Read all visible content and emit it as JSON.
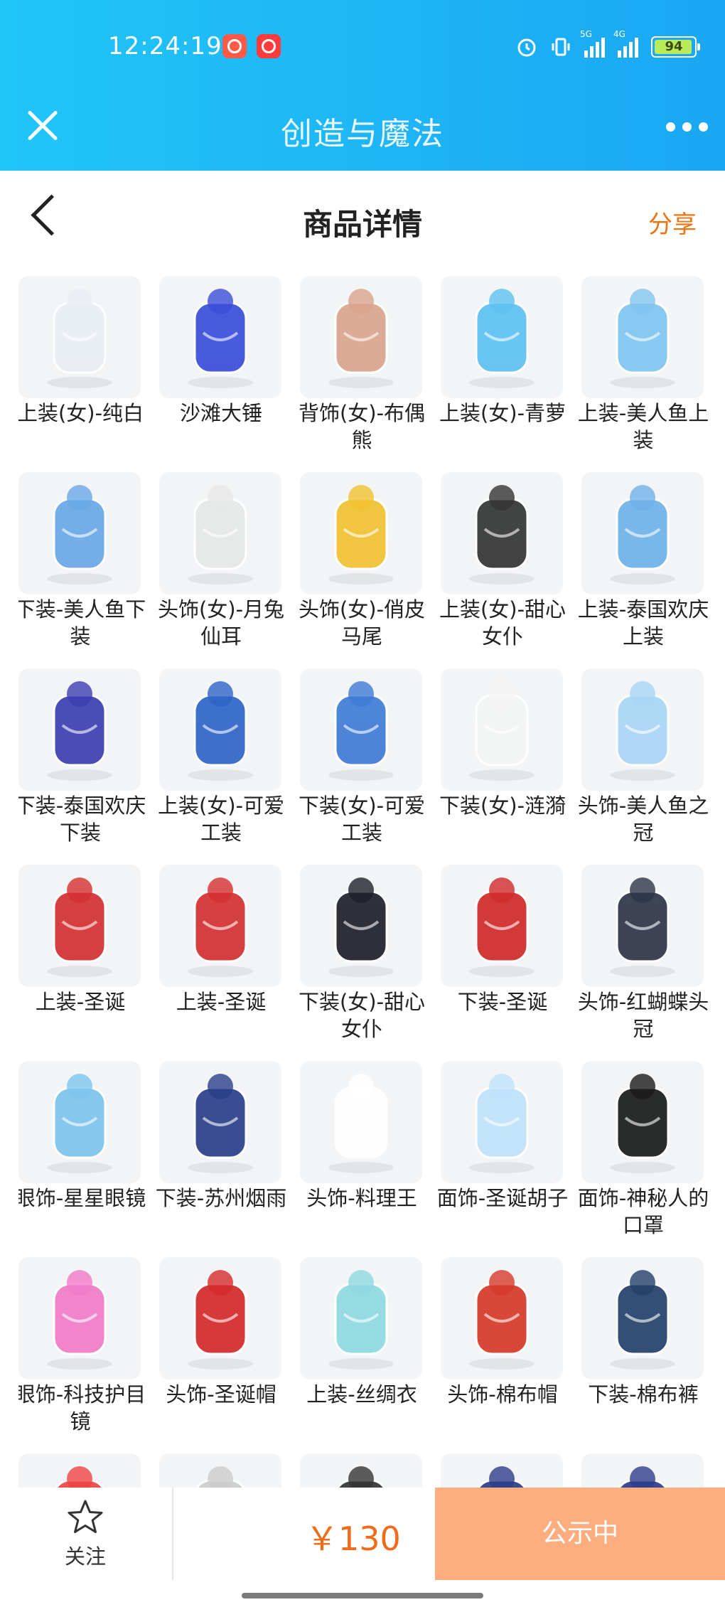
{
  "status_bar": {
    "time": "12:24:19",
    "network1": "5G",
    "network2": "4G",
    "battery": "94"
  },
  "app_bar": {
    "title": "创造与魔法"
  },
  "page_header": {
    "title": "商品详情",
    "share_label": "分享"
  },
  "items": [
    {
      "label": "上装(女)-纯白",
      "icon": "white-dress-icon",
      "color": "#e9edf3"
    },
    {
      "label": "沙滩大锤",
      "icon": "hammer-icon",
      "color": "#3a4ed8"
    },
    {
      "label": "背饰(女)-布偶熊",
      "icon": "teddy-bear-icon",
      "color": "#d9a48d"
    },
    {
      "label": "上装(女)-青萝",
      "icon": "blue-dress-icon",
      "color": "#5ec0f0"
    },
    {
      "label": "上装-美人鱼上装",
      "icon": "mermaid-top-icon",
      "color": "#7fc4f0"
    },
    {
      "label": "下装-美人鱼下装",
      "icon": "mermaid-pants-icon",
      "color": "#6aa8e8"
    },
    {
      "label": "头饰(女)-月兔仙耳",
      "icon": "bunny-ears-icon",
      "color": "#e7e7e7"
    },
    {
      "label": "头饰(女)-俏皮马尾",
      "icon": "ponytail-icon",
      "color": "#f2c030"
    },
    {
      "label": "上装(女)-甜心女仆",
      "icon": "maid-dress-icon",
      "color": "#333333"
    },
    {
      "label": "上装-泰国欢庆上装",
      "icon": "thai-top-icon",
      "color": "#6fb1e8"
    },
    {
      "label": "下装-泰国欢庆下装",
      "icon": "thai-pants-icon",
      "color": "#3b3fb0"
    },
    {
      "label": "上装(女)-可爱工装",
      "icon": "overalls-icon",
      "color": "#2e64c8"
    },
    {
      "label": "下装(女)-可爱工装",
      "icon": "jeans-icon",
      "color": "#3f7bd6"
    },
    {
      "label": "下装(女)-涟漪",
      "icon": "stockings-icon",
      "color": "#f4f4f4"
    },
    {
      "label": "头饰-美人鱼之冠",
      "icon": "crown-icon",
      "color": "#a9d6f5"
    },
    {
      "label": "上装-圣诞",
      "icon": "christmas-coat-icon",
      "color": "#d43030"
    },
    {
      "label": "上装-圣诞",
      "icon": "christmas-coat-icon",
      "color": "#d43030"
    },
    {
      "label": "下装(女)-甜心女仆",
      "icon": "maid-shoes-icon",
      "color": "#1f1f2a"
    },
    {
      "label": "下装-圣诞",
      "icon": "christmas-boots-icon",
      "color": "#d02a2a"
    },
    {
      "label": "头饰-红蝴蝶头冠",
      "icon": "butterfly-hair-icon",
      "color": "#2e3548"
    },
    {
      "label": "眼饰-星星眼镜",
      "icon": "star-glasses-icon",
      "color": "#7ec4ee"
    },
    {
      "label": "下装-苏州烟雨",
      "icon": "shorts-icon",
      "color": "#2b3f8a"
    },
    {
      "label": "头饰-料理王",
      "icon": "chef-hat-icon",
      "color": "#ffffff"
    },
    {
      "label": "面饰-圣诞胡子",
      "icon": "beard-icon",
      "color": "#bfe2fb"
    },
    {
      "label": "面饰-神秘人的口罩",
      "icon": "mask-icon",
      "color": "#1a1a1a"
    },
    {
      "label": "眼饰-科技护目镜",
      "icon": "goggles-icon",
      "color": "#f07bc8"
    },
    {
      "label": "头饰-圣诞帽",
      "icon": "santa-hat-icon",
      "color": "#d42a2a"
    },
    {
      "label": "上装-丝绸衣",
      "icon": "silk-shirt-icon",
      "color": "#8fd8e0"
    },
    {
      "label": "头饰-棉布帽",
      "icon": "dino-hat-icon",
      "color": "#d53a2a"
    },
    {
      "label": "下装-棉布裤",
      "icon": "cotton-pants-icon",
      "color": "#24406a"
    },
    {
      "label": "",
      "icon": "partial-item-icon",
      "color": "#e44"
    },
    {
      "label": "",
      "icon": "partial-item-icon",
      "color": "#ccc"
    },
    {
      "label": "",
      "icon": "partial-item-icon",
      "color": "#333"
    },
    {
      "label": "",
      "icon": "partial-item-icon",
      "color": "#2d3d8a"
    },
    {
      "label": "",
      "icon": "partial-item-icon",
      "color": "#2d3d8a"
    }
  ],
  "bottom_bar": {
    "follow_label": "关注",
    "price": "￥130",
    "cta_label": "公示中"
  },
  "colors": {
    "accent": "#ee7412",
    "topbar": "#1fb6f6",
    "cta": "#fdad7e"
  }
}
